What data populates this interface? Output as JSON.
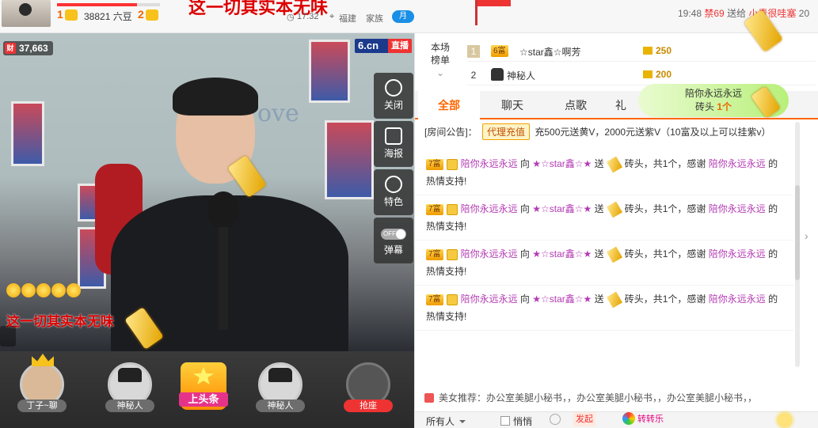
{
  "topbar": {
    "level_left": "1",
    "beans": "38821 六豆",
    "level_right": "2",
    "slogan": "这一切其实本无味",
    "time": "17:32",
    "location": "福建",
    "family": "家族",
    "month_badge": "月",
    "right_time": "19:48",
    "ban_label": "禁69",
    "send_label": "送给",
    "recipient": "小青很哇塞",
    "tail": "20"
  },
  "video": {
    "viewer_badge": "财",
    "viewer_count": "37,663",
    "logo": "6.cn",
    "live_label": "直播",
    "wall_text": "ove",
    "slogan": "这一切其实本无味",
    "controls": [
      {
        "label": "关闭"
      },
      {
        "label": "海报"
      },
      {
        "label": "特色"
      },
      {
        "label": "弹幕",
        "toggle": "OFF"
      }
    ]
  },
  "seats": [
    {
      "name": "丁子~聊"
    },
    {
      "name": "神秘人"
    },
    {
      "name": "神秘人"
    },
    {
      "name": "抢座"
    }
  ],
  "headline": {
    "label": "上头条"
  },
  "ranking": {
    "tab_label_1": "本场",
    "tab_label_2": "榜单",
    "rows": [
      {
        "rank": "1",
        "badge": "6富",
        "name": "☆star鑫☆啊芳",
        "value": "250"
      },
      {
        "rank": "2",
        "badge": "",
        "name": "神秘人",
        "value": "200"
      }
    ]
  },
  "tabs": [
    {
      "label": "全部"
    },
    {
      "label": "聊天"
    },
    {
      "label": "点歌"
    },
    {
      "label": "礼"
    }
  ],
  "promo": {
    "line1": "陪你永远永远",
    "gift": "砖头",
    "count": "1个"
  },
  "notice": {
    "prefix": "[房间公告]：",
    "tag": "代理充值",
    "text": "充500元送黄V，2000元送紫V（10富及以上可以挂紫v）"
  },
  "messages": [
    {
      "badge": "7富",
      "sender": "陪你永远永远",
      "to": "向",
      "receiver": "★☆star鑫☆★",
      "send": "送",
      "gift": "砖头，共1个，感谢",
      "thanks_user": "陪你永远永远",
      "end": "的",
      "tail": "热情支持!"
    },
    {
      "badge": "7富",
      "sender": "陪你永远永远",
      "to": "向",
      "receiver": "★☆star鑫☆★",
      "send": "送",
      "gift": "砖头，共1个，感谢",
      "thanks_user": "陪你永远永远",
      "end": "的",
      "tail": "热情支持!"
    },
    {
      "badge": "7富",
      "sender": "陪你永远永远",
      "to": "向",
      "receiver": "★☆star鑫☆★",
      "send": "送",
      "gift": "砖头，共1个，感谢",
      "thanks_user": "陪你永远永远",
      "end": "的",
      "tail": "热情支持!"
    },
    {
      "badge": "7富",
      "sender": "陪你永远永远",
      "to": "向",
      "receiver": "★☆star鑫☆★",
      "send": "送",
      "gift": "砖头，共1个，感谢",
      "thanks_user": "陪你永远永远",
      "end": "的",
      "tail": "热情支持!"
    }
  ],
  "recommend": {
    "label": "美女推荐",
    "text": "：办公室美腿小秘书，，办公室美腿小秘书，，办公室美腿小秘书，，"
  },
  "bottombar": {
    "to": "所有人",
    "quiet": "悄悄",
    "fire": "发起",
    "zhuan": "转转乐"
  }
}
